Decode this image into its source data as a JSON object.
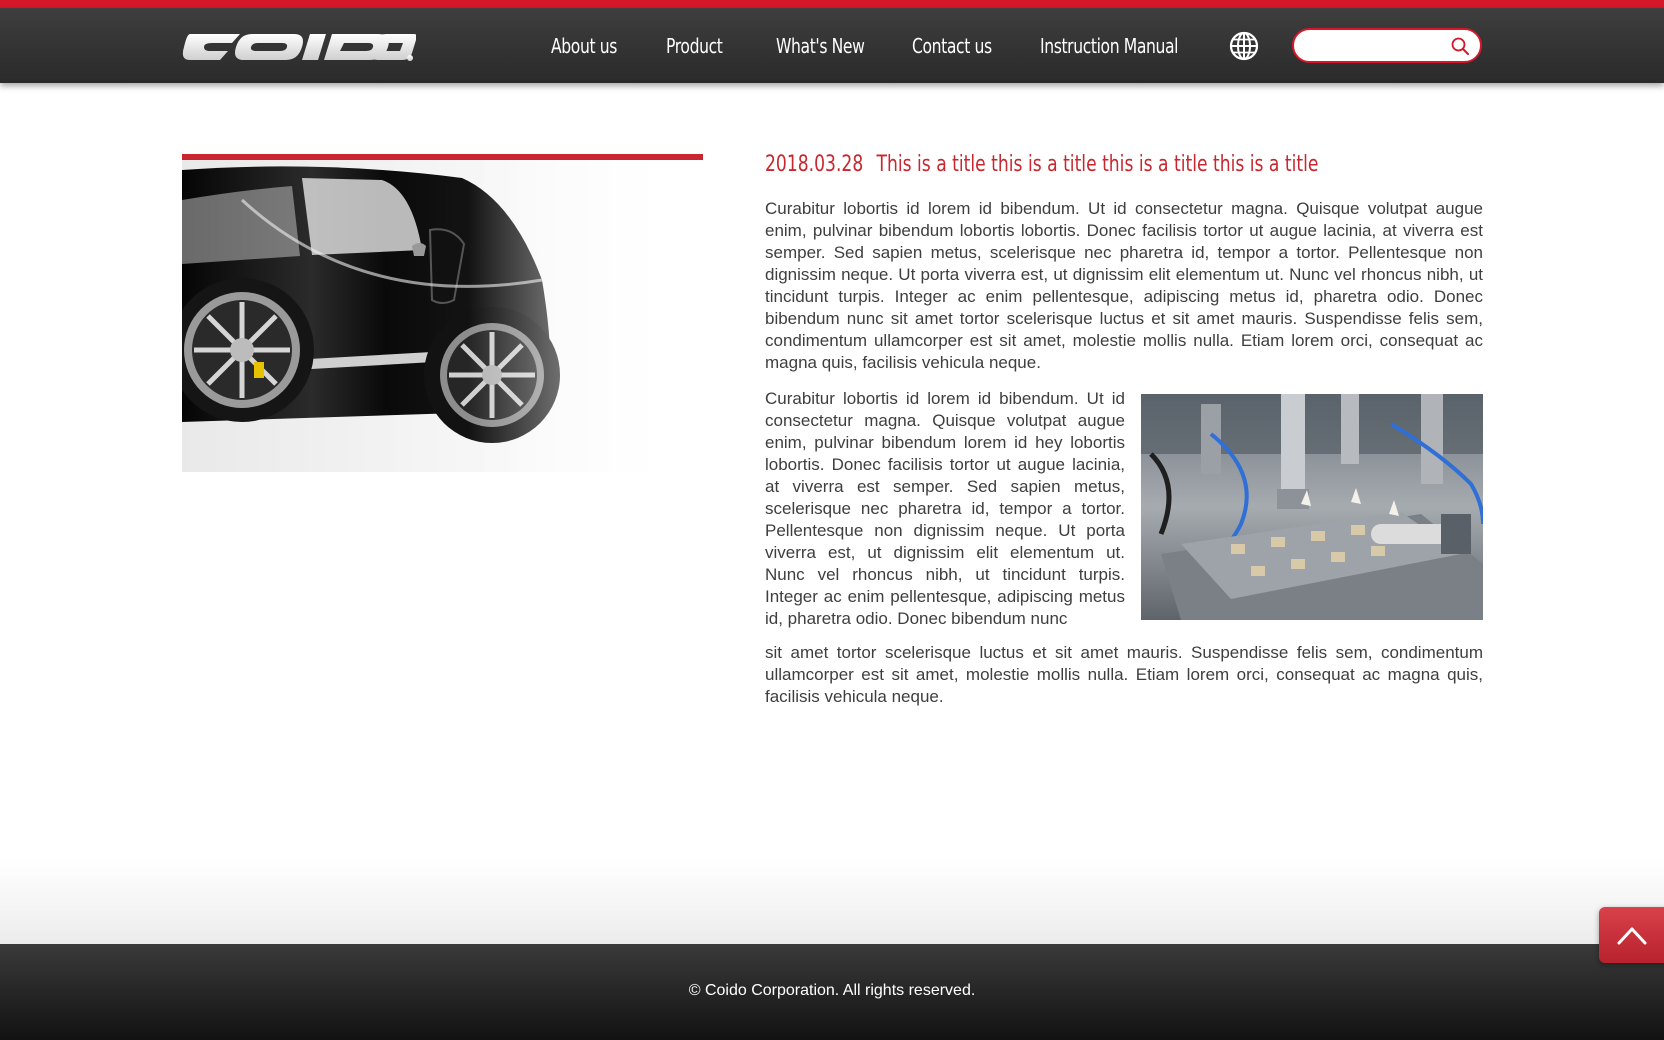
{
  "brand": {
    "logo_text": "COIDO",
    "accent_color": "#d6172a",
    "title_color": "#c8272f"
  },
  "nav": {
    "items": [
      {
        "label": "About us"
      },
      {
        "label": "Product"
      },
      {
        "label": "What's New"
      },
      {
        "label": "Contact us"
      },
      {
        "label": "Instruction Manual"
      }
    ],
    "language_icon": "globe-icon"
  },
  "search": {
    "value": "",
    "placeholder": "",
    "icon": "search-icon"
  },
  "article": {
    "date": "2018.03.28",
    "title": "This is a title this is a title this is a title this is a title",
    "paragraph1": "Curabitur lobortis id lorem id bibendum. Ut id consectetur magna. Quisque volutpat augue enim, pulvinar bibendum lobortis lobortis. Donec facilisis tortor ut augue lacinia, at viverra est semper. Sed sapien metus, scelerisque nec pharetra id, tempor a tortor. Pellentesque non dignissim neque. Ut porta viverra est, ut dignissim elit elementum ut. Nunc vel rhoncus nibh, ut tincidunt turpis. Integer ac enim pellentesque, adipiscing metus id, pharetra odio. Donec bibendum nunc sit amet tortor scelerisque luctus et sit amet mauris. Suspendisse felis sem, condimentum ullamcorper est sit amet, molestie mollis nulla. Etiam lorem orci, consequat ac magna quis, facilisis vehicula neque.",
    "paragraph2": "Curabitur lobortis id lorem id bibendum. Ut id consectetur magna. Quisque volutpat augue enim, pulvinar bibendum lorem id hey lobortis lobortis. Donec facilisis tortor ut augue lacinia, at viverra est semper. Sed sapien metus, scelerisque nec pharetra id, tempor a tortor. Pellentesque non dignissim neque. Ut porta viverra est, ut dignissim elit elementum ut. Nunc vel rhoncus nibh, ut tincidunt turpis. Integer ac enim pellentesque, adipiscing metus id, pharetra odio. Donec bibendum nunc",
    "paragraph3": "sit amet tortor scelerisque luctus et sit amet mauris. Suspendisse felis sem, condimentum ullamcorper est sit amet, molestie mollis nulla. Etiam lorem orci, consequat ac magna quis, facilisis vehicula neque."
  },
  "footer": {
    "copyright": "© Coido Corporation. All rights reserved."
  },
  "back_to_top": {
    "icon": "chevron-up-icon"
  }
}
